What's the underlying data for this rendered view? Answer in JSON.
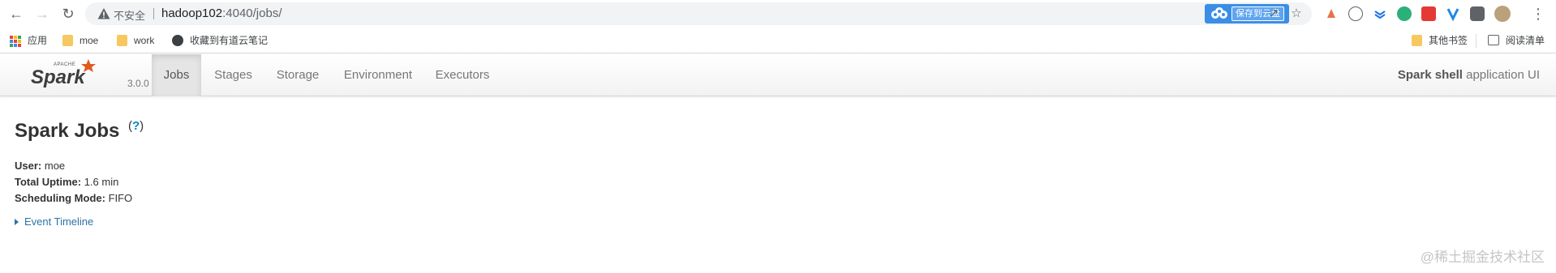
{
  "browser": {
    "insecure_label": "不安全",
    "url_host": "hadoop102",
    "url_rest": ":4040/jobs/",
    "cloud_extension_label": "保存到云盘"
  },
  "bookmarks": {
    "apps": "应用",
    "moe": "moe",
    "work": "work",
    "youdao": "收藏到有道云笔记",
    "other": "其他书签",
    "reading_list": "阅读清单"
  },
  "spark": {
    "logo_text": "Spark",
    "logo_apache": "APACHE",
    "version": "3.0.0",
    "tabs": [
      {
        "label": "Jobs",
        "active": true
      },
      {
        "label": "Stages",
        "active": false
      },
      {
        "label": "Storage",
        "active": false
      },
      {
        "label": "Environment",
        "active": false
      },
      {
        "label": "Executors",
        "active": false
      }
    ],
    "app_name": "Spark shell",
    "app_suffix": " application UI"
  },
  "content": {
    "title": "Spark Jobs",
    "help_open": "(",
    "help_mark": "?",
    "help_close": ")",
    "user_label": "User:",
    "user_value": " moe",
    "uptime_label": "Total Uptime:",
    "uptime_value": " 1.6 min",
    "scheduling_label": "Scheduling Mode:",
    "scheduling_value": " FIFO",
    "event_timeline": "Event Timeline"
  },
  "watermark": "@稀土掘金技术社区",
  "colors": {
    "link": "#0088cc",
    "spark_orange": "#e25a1c",
    "navbar_active": "#e5e5e5"
  }
}
